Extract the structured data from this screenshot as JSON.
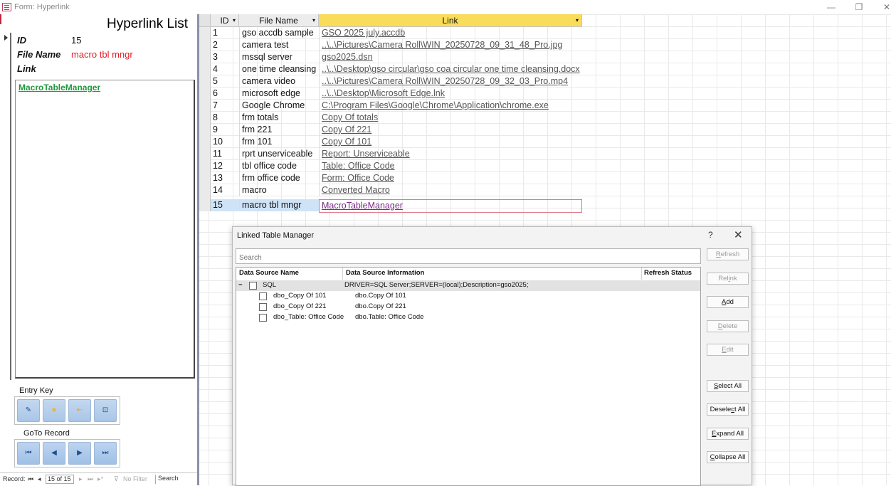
{
  "window": {
    "title": "Form: Hyperlink",
    "controls": [
      "—",
      "❐",
      "✕"
    ]
  },
  "form": {
    "heading": "Hyperlink List",
    "fields": {
      "id_label": "ID",
      "id_value": "15",
      "file_name_label": "File Name",
      "file_name_value": "macro tbl mngr",
      "link_label": "Link",
      "link_value": "MacroTableManager"
    },
    "entry_key_label": "Entry Key",
    "entry_key_icons": [
      "edit-icon",
      "lock-icon",
      "close-form-icon",
      "preview-icon"
    ],
    "goto_label": "GoTo Record",
    "goto_icons": [
      "first-record-icon",
      "previous-record-icon",
      "next-record-icon",
      "last-record-icon"
    ],
    "colors": {
      "file_name_value": "#e0202a",
      "link_value": "#1e9a3a"
    }
  },
  "statusbar": {
    "record_label": "Record:",
    "record_position": "15 of 15",
    "filter": "No Filter",
    "search": "Search"
  },
  "sheet": {
    "headers": {
      "id": "ID",
      "file_name": "File Name",
      "link": "Link"
    },
    "rows": [
      {
        "id": "1",
        "name": "gso accdb sample",
        "link": "GSO 2025 july.accdb"
      },
      {
        "id": "2",
        "name": "camera test",
        "link": "..\\..\\Pictures\\Camera Roll\\WIN_20250728_09_31_48_Pro.jpg"
      },
      {
        "id": "3",
        "name": "mssql server",
        "link": "gso2025.dsn"
      },
      {
        "id": "4",
        "name": "one time cleansing",
        "link": "..\\..\\Desktop\\gso circular\\gso coa circular one time cleansing.docx"
      },
      {
        "id": "5",
        "name": "camera video",
        "link": "..\\..\\Pictures\\Camera Roll\\WIN_20250728_09_32_03_Pro.mp4"
      },
      {
        "id": "6",
        "name": "microsoft edge",
        "link": "..\\..\\Desktop\\Microsoft Edge.lnk"
      },
      {
        "id": "7",
        "name": "Google Chrome",
        "link": "C:\\Program Files\\Google\\Chrome\\Application\\chrome.exe"
      },
      {
        "id": "8",
        "name": "frm totals",
        "link": "Copy Of totals"
      },
      {
        "id": "9",
        "name": "frm 221",
        "link": "Copy Of 221"
      },
      {
        "id": "10",
        "name": "frm 101",
        "link": "Copy Of 101"
      },
      {
        "id": "11",
        "name": "rprt unserviceable",
        "link": "Report: Unserviceable"
      },
      {
        "id": "12",
        "name": "tbl office code",
        "link": "Table: Office Code"
      },
      {
        "id": "13",
        "name": "frm office code",
        "link": "Form: Office Code"
      },
      {
        "id": "14",
        "name": "macro",
        "link": "Converted Macro"
      },
      {
        "id": "15",
        "name": "macro tbl mngr",
        "link": "MacroTableManager"
      }
    ]
  },
  "dialog": {
    "title": "Linked Table Manager",
    "help": "?",
    "close": "✕",
    "search_placeholder": "Search",
    "columns": {
      "name": "Data Source Name",
      "info": "Data Source Information",
      "status": "Refresh Status"
    },
    "group": {
      "toggle": "−",
      "name": "SQL",
      "info": "DRIVER=SQL Server;SERVER=(local);Description=gso2025;"
    },
    "items": [
      {
        "name": "dbo_Copy Of 101",
        "info": "dbo.Copy Of 101"
      },
      {
        "name": "dbo_Copy Of 221",
        "info": "dbo.Copy Of 221"
      },
      {
        "name": "dbo_Table: Office Code",
        "info": "dbo.Table: Office Code"
      }
    ],
    "buttons": {
      "refresh": {
        "key": "R",
        "rest": "efresh"
      },
      "relink": {
        "pre": "Rel",
        "key": "i",
        "rest": "nk"
      },
      "add": {
        "key": "A",
        "rest": "dd"
      },
      "delete": {
        "key": "D",
        "rest": "elete"
      },
      "edit": {
        "key": "E",
        "rest": "dit"
      },
      "select_all": {
        "key": "S",
        "rest": "elect All"
      },
      "deselect_all": {
        "pre": "Desele",
        "key": "c",
        "rest": "t All"
      },
      "expand_all": {
        "key": "E",
        "rest": "xpand All"
      },
      "collapse_all": {
        "key": "C",
        "rest": "ollapse All"
      }
    }
  }
}
